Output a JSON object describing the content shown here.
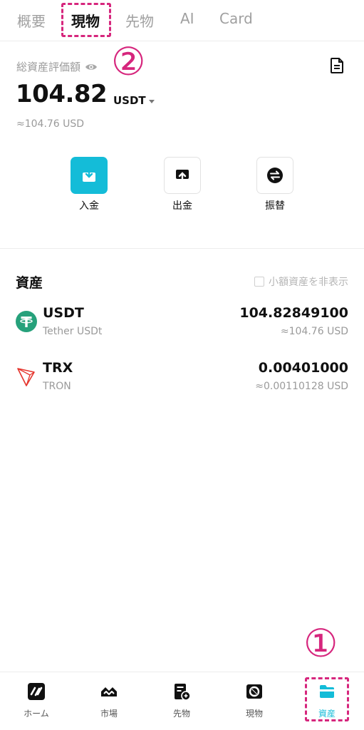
{
  "tabs": {
    "overview": "概要",
    "spot": "現物",
    "futures": "先物",
    "ai": "AI",
    "card": "Card"
  },
  "annotations": {
    "step1": "①",
    "step2": "②",
    "color": "#d6267d"
  },
  "balance": {
    "label": "総資産評価額",
    "amount": "104.82",
    "unit": "USDT",
    "approx": "≈104.76 USD"
  },
  "actions": {
    "deposit": "入金",
    "withdraw": "出金",
    "transfer": "振替"
  },
  "assets": {
    "title": "資産",
    "hide_small": "小額資産を非表示",
    "rows": [
      {
        "symbol": "USDT",
        "name": "Tether USDt",
        "amount": "104.82849100",
        "usd": "≈104.76  USD",
        "icon": "tether-icon"
      },
      {
        "symbol": "TRX",
        "name": "TRON",
        "amount": "0.00401000",
        "usd": "≈0.00110128  USD",
        "icon": "tron-icon"
      }
    ]
  },
  "nav": {
    "home": "ホーム",
    "market": "市場",
    "futures": "先物",
    "spot": "現物",
    "assets": "資産"
  },
  "colors": {
    "accent": "#14bcd8",
    "tether": "#26a17b",
    "tron": "#e5372f"
  }
}
